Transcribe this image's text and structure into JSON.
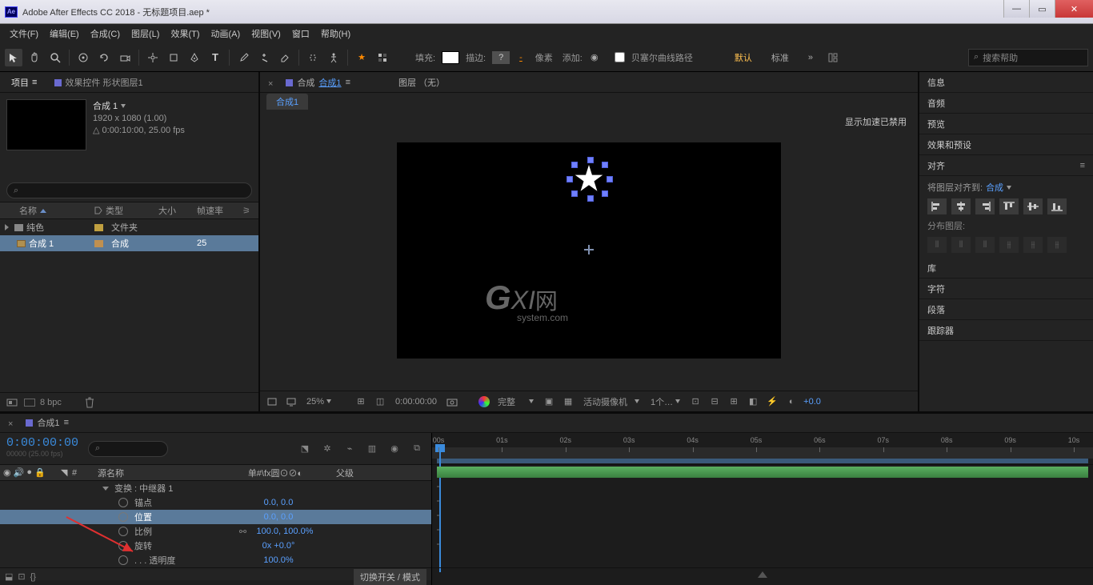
{
  "titlebar": {
    "app_icon": "Ae",
    "title": "Adobe After Effects CC 2018 - 无标题项目.aep *"
  },
  "menu": [
    "文件(F)",
    "编辑(E)",
    "合成(C)",
    "图层(L)",
    "效果(T)",
    "动画(A)",
    "视图(V)",
    "窗口",
    "帮助(H)"
  ],
  "toolbar": {
    "fill_label": "填充:",
    "stroke_label": "描边:",
    "px_label": "像素",
    "px_value": "-",
    "add_label": "添加:",
    "bezier_label": "贝塞尔曲线路径",
    "workspace_default": "默认",
    "workspace_standard": "标准",
    "more": "»",
    "search_placeholder": "搜索帮助"
  },
  "project": {
    "tab1": "项目",
    "tab2": "效果控件 形状图层1",
    "comp_name": "合成 1",
    "res": "1920 x 1080 (1.00)",
    "dur": "0:00:10:00, 25.00 fps",
    "dur_prefix": "△",
    "cols": {
      "name": "名称",
      "type": "类型",
      "size": "大小",
      "fps": "帧速率"
    },
    "items": [
      {
        "name": "纯色",
        "type": "文件夹",
        "fps": "",
        "kind": "folder"
      },
      {
        "name": "合成 1",
        "type": "合成",
        "fps": "25",
        "kind": "comp",
        "selected": true
      }
    ],
    "footer_bpc": "8 bpc"
  },
  "viewer": {
    "tab_prefix": "合成",
    "tab_name": "合成1",
    "layer_tab": "图层 （无）",
    "subtab": "合成1",
    "accel_msg": "显示加速已禁用",
    "zoom": "25%",
    "timecode": "0:00:00:00",
    "quality": "完整",
    "camera": "活动摄像机",
    "views": "1个…",
    "exposure": "+0.0",
    "watermark": {
      "g": "G",
      "xi": "XI",
      "cn": "网",
      "sys": "system.com"
    }
  },
  "rpanels": {
    "info": "信息",
    "audio": "音频",
    "preview": "预览",
    "effects": "效果和预设",
    "align": "对齐",
    "align_to_label": "将图层对齐到:",
    "align_to_value": "合成",
    "distribute_label": "分布图层:",
    "library": "库",
    "character": "字符",
    "paragraph": "段落",
    "tracker": "跟踪器"
  },
  "timeline": {
    "tab": "合成1",
    "timecode": "0:00:00:00",
    "frame_info": "00000 (25.00 fps)",
    "col_num": "#",
    "col_name": "源名称",
    "col_parent": "父级",
    "switches": "单#\\fx圆⊙⊘◐",
    "rows": [
      {
        "kind": "group",
        "name": "变换 : 中继器 1",
        "indent": 1
      },
      {
        "kind": "prop",
        "name": "锚点",
        "value": "0.0, 0.0"
      },
      {
        "kind": "prop",
        "name": "位置",
        "value": "0.0, 0.0",
        "selected": true
      },
      {
        "kind": "prop",
        "name": "比例",
        "value": "100.0, 100.0%",
        "linked": true
      },
      {
        "kind": "prop",
        "name": "旋转",
        "value": "0x +0.0°"
      },
      {
        "kind": "prop",
        "name": ". . . 透明度",
        "value": "100.0%"
      }
    ],
    "footer_toggle": "切换开关 / 模式",
    "ruler": [
      "00s",
      "01s",
      "02s",
      "03s",
      "04s",
      "05s",
      "06s",
      "07s",
      "08s",
      "09s",
      "10s"
    ]
  }
}
